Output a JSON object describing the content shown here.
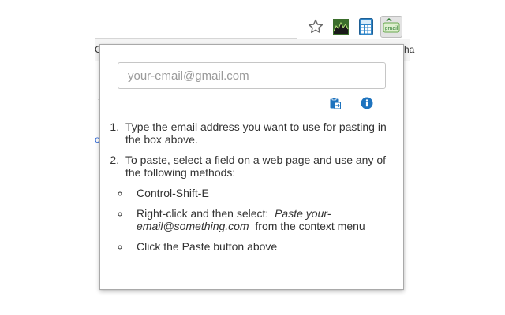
{
  "toolbar": {
    "icons": [
      "star-icon",
      "graph-extension-icon",
      "calculator-icon",
      "email-paste-extension-icon"
    ],
    "extension_badge": "gmail"
  },
  "bookmarks": {
    "left_fragment": "C",
    "right_fragment": "ha"
  },
  "page_fragment": "o",
  "popup": {
    "email_placeholder": "your-email@gmail.com",
    "email_value": "",
    "paste_icon": "clipboard-paste-icon",
    "info_icon": "info-icon",
    "step1": "Type the email address you want to use for pasting in the box above.",
    "step2": "To paste, select a field on a web page and use any of the following methods:",
    "method1": "Control-Shift-E",
    "method2_prefix": "Right-click and then select:",
    "method2_em": "Paste your-email@something.com",
    "method2_suffix": "from the context menu",
    "method3": "Click the Paste button above"
  },
  "colors": {
    "accent": "#1e73be",
    "text": "#333333",
    "placeholder": "#9a9a9a",
    "border": "#a9a9a9"
  }
}
